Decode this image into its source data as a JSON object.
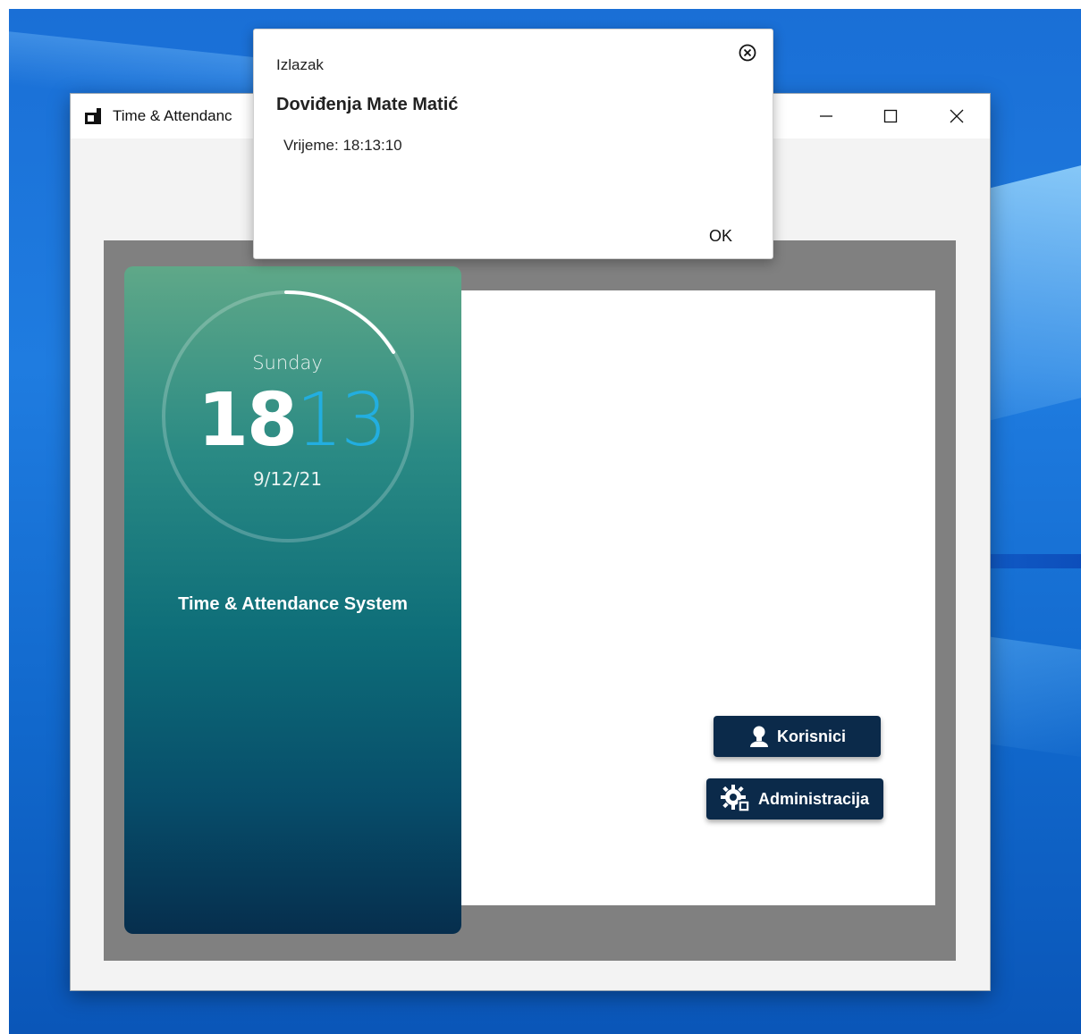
{
  "window": {
    "title": "Time & Attendanc",
    "controls": {
      "minimize": "—",
      "maximize": "☐",
      "close": "✕"
    }
  },
  "clock": {
    "day": "Sunday",
    "hours": "18",
    "minutes": "13",
    "date": "9/12/21",
    "minute_color": "#22aee0"
  },
  "sidebar": {
    "system_title": "Time & Attendance System"
  },
  "actions": {
    "users_label": "Korisnici",
    "users_icon": "user-icon",
    "admin_label": "Administracija",
    "admin_icon": "gear-icon"
  },
  "popup": {
    "caption": "Izlazak",
    "heading": "Doviđenja Mate  Matić",
    "time_text": "Vrijeme: 18:13:10",
    "ok_label": "OK",
    "close_icon": "close-circle-icon"
  },
  "colors": {
    "button_bg": "#0b2a4a",
    "card_top": "#5fa888",
    "card_bottom": "#062e4d",
    "frame_gray": "#808080"
  }
}
